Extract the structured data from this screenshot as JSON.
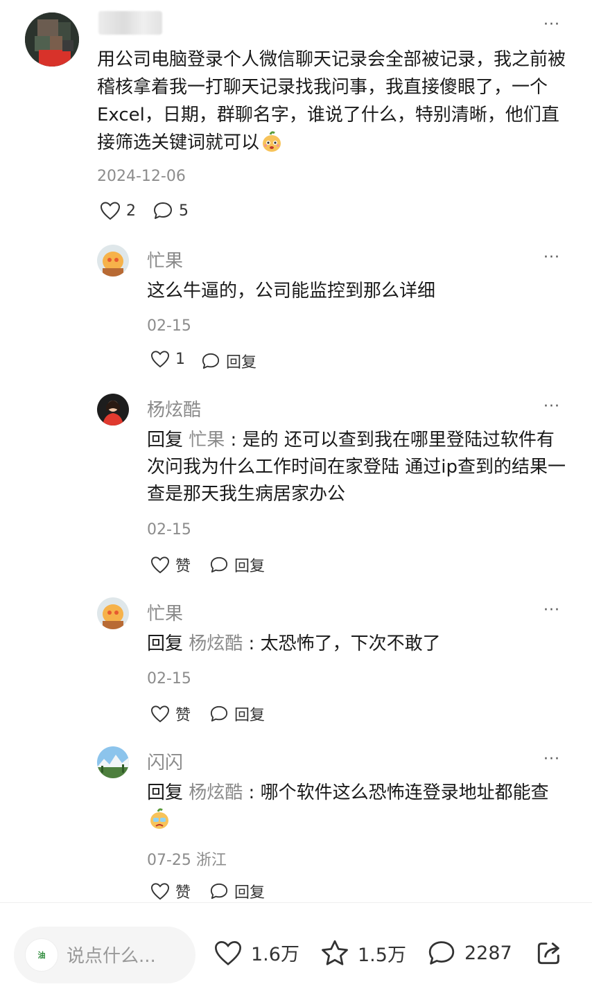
{
  "main": {
    "text": "用公司电脑登录个人微信聊天记录会全部被记录，我之前被稽核拿着我一打聊天记录找我问事，我直接傻眼了，一个Excel，日期，群聊名字，谁说了什么，特别清晰，他们直接筛选关键词就可以",
    "emoji_icon": "mango-face-emoji",
    "date": "2024-12-06",
    "likes": "2",
    "comments": "5",
    "more": "···"
  },
  "replies": [
    {
      "name": "忙果",
      "prefix": "",
      "target": "",
      "sep": "",
      "text": "这么牛逼的，公司能监控到那么详细",
      "date": "02-15",
      "like_label": "1",
      "reply_label": "回复",
      "more": "···"
    },
    {
      "name": "杨炫酷",
      "prefix": "回复",
      "target": "忙果",
      "sep": " : ",
      "text": "是的 还可以查到我在哪里登陆过软件有次问我为什么工作时间在家登陆 通过ip查到的结果一查是那天我生病居家办公",
      "date": "02-15",
      "like_label": "赞",
      "reply_label": "回复",
      "more": "···"
    },
    {
      "name": "忙果",
      "prefix": "回复",
      "target": "杨炫酷",
      "sep": " : ",
      "text": "太恐怖了，下次不敢了",
      "date": "02-15",
      "like_label": "赞",
      "reply_label": "回复",
      "more": "···"
    },
    {
      "name": "闪闪",
      "prefix": "回复",
      "target": "杨炫酷",
      "sep": " : ",
      "text": "哪个软件这么恐怖连登录地址都能查",
      "date": "07-25 浙江",
      "like_label": "赞",
      "reply_label": "回复",
      "more": "···"
    }
  ],
  "bottom_bar": {
    "input_placeholder": "说点什么...",
    "avatar_text": "油",
    "likes": "1.6万",
    "favorites": "1.5万",
    "comments": "2287"
  }
}
